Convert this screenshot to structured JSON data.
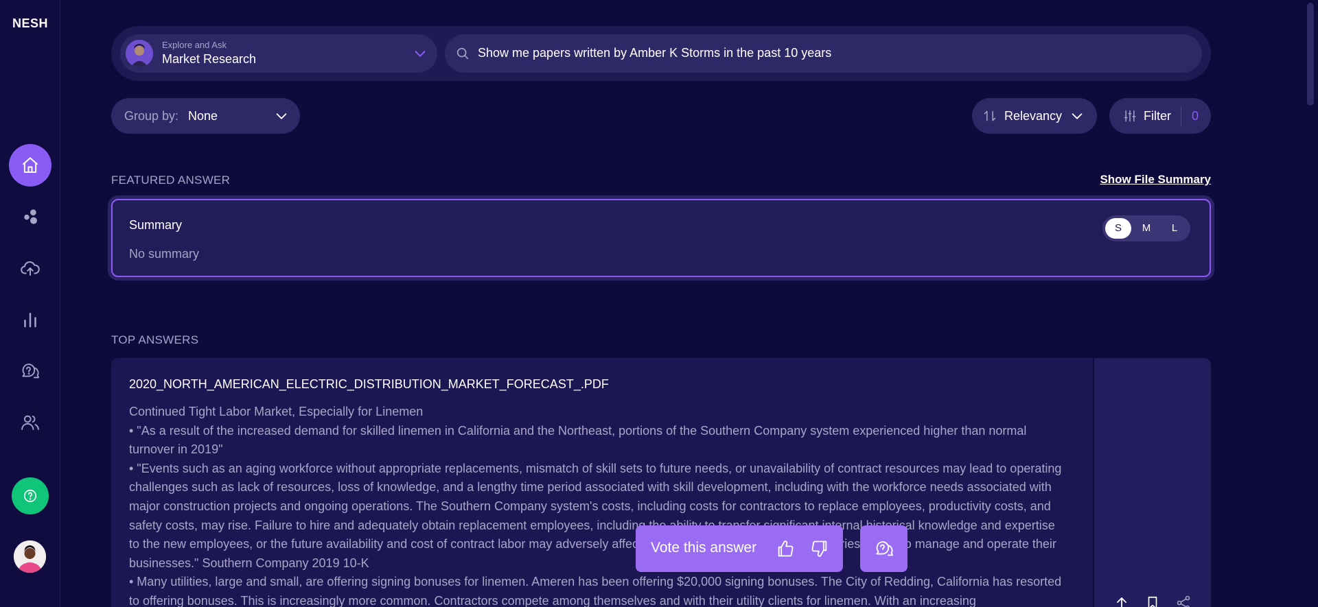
{
  "app": {
    "logo": "NESH"
  },
  "sidebar": {
    "items": [
      {
        "icon": "home-icon",
        "active": true
      },
      {
        "icon": "bubbles-icon"
      },
      {
        "icon": "upload-cloud-icon"
      },
      {
        "icon": "bar-chart-icon"
      },
      {
        "icon": "chat-question-icon"
      },
      {
        "icon": "users-icon"
      }
    ]
  },
  "search": {
    "context_sub": "Explore and Ask",
    "context_title": "Market Research",
    "query": "Show me papers written by Amber K Storms in the past 10 years"
  },
  "toolbar": {
    "group_by_label": "Group by:",
    "group_by_value": "None",
    "sort_label": "Relevancy",
    "filter_label": "Filter",
    "filter_count": "0"
  },
  "featured": {
    "section_title": "FEATURED ANSWER",
    "show_summary": "Show File Summary",
    "title": "Summary",
    "body": "No summary",
    "sizes": [
      "S",
      "M",
      "L"
    ],
    "selected_size": "S"
  },
  "top_answers": {
    "section_title": "TOP ANSWERS",
    "file": "2020_NORTH_AMERICAN_ELECTRIC_DISTRIBUTION_MARKET_FORECAST_.PDF",
    "heading": "Continued Tight Labor Market, Especially for Linemen",
    "bullet1": "• \"As a result of the increased demand for skilled linemen in California and the Northeast, portions of the Southern Company system experienced higher than normal turnover in 2019\"",
    "bullet2": "• \"Events such as an aging workforce without appropriate replacements, mismatch of skill sets to future needs, or unavailability of contract resources may lead to operating challenges such as lack of resources, loss of knowledge, and a lengthy time period associated with skill development, including with the workforce needs associated with major construction projects and ongoing operations. The Southern Company system's costs, including costs for contractors to replace employees, productivity costs, and safety costs, may rise. Failure to hire and adequately obtain replacement employees, including the ability to transfer significant internal historical knowledge and expertise to the new employees, or the future availability and cost of contract labor may adversely affect Southern Company and its subsidiaries' ability to manage and operate their businesses.\" Southern Company 2019 10-K",
    "bullet3": "• Many utilities, large and small, are offering signing bonuses for linemen. Ameren has been offering $20,000 signing bonuses. The City of Redding, California has resorted to offering bonuses. This is increasingly more common. Contractors compete among themselves and with their utility clients for linemen. With an increasing"
  },
  "vote": {
    "label": "Vote this answer"
  },
  "colors": {
    "accent": "#8a5cf6",
    "background": "#0e0a3c",
    "help": "#10c47a"
  }
}
